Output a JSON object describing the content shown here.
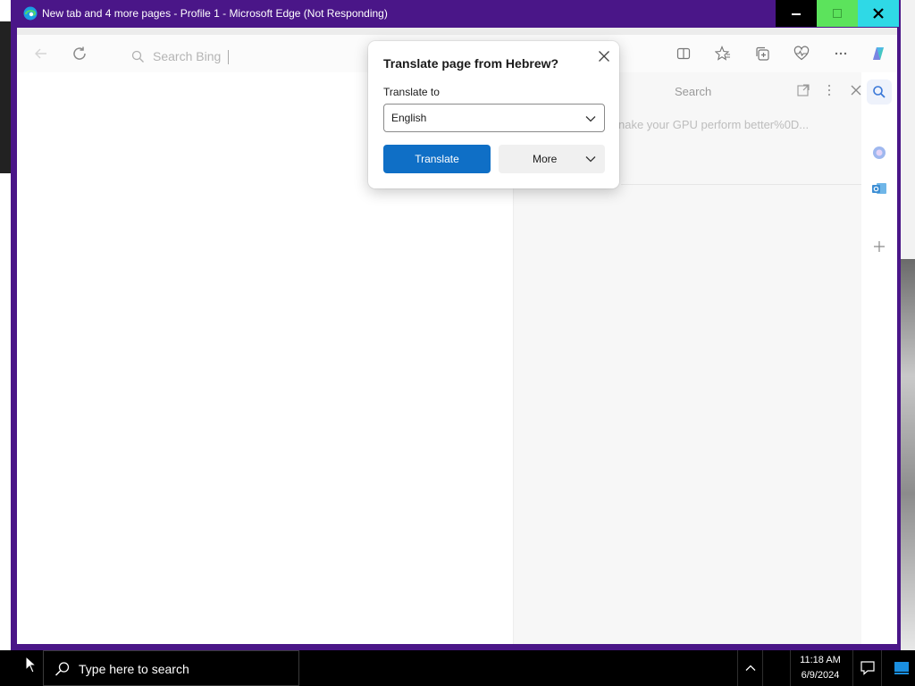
{
  "window": {
    "title": "New tab and 4 more pages - Profile 1 - Microsoft Edge (Not Responding)"
  },
  "toolbar": {
    "search_placeholder": "Search Bing"
  },
  "side_panel": {
    "title": "Search",
    "query_text": "nake your GPU perform better%0D..."
  },
  "translate_popup": {
    "title": "Translate page from Hebrew?",
    "translate_to_label": "Translate to",
    "selected_language": "English",
    "translate_button": "Translate",
    "more_button": "More"
  },
  "taskbar": {
    "search_placeholder": "Type here to search",
    "time": "11:18 AM",
    "date": "6/9/2024"
  },
  "colors": {
    "window_frame": "#4a1688",
    "primary_button": "#0f6fc6",
    "minimize_bg": "#000000",
    "maximize_bg": "#5ce35c",
    "close_bg": "#2fd9e6"
  }
}
